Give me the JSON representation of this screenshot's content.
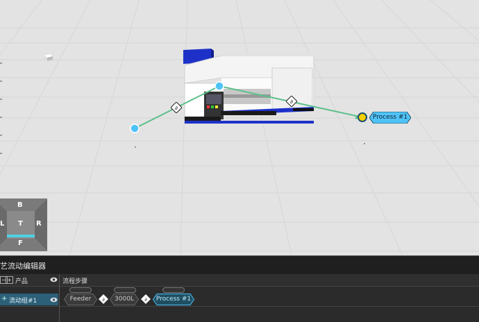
{
  "viewport": {
    "process_tag": "Process #1",
    "nav_cube": {
      "top": "B",
      "left": "L",
      "center": "T",
      "right": "R",
      "bottom": "F"
    }
  },
  "editor": {
    "title": "艺流动编辑器",
    "products_header": "产品",
    "steps_header": "流程步骤",
    "product_item": "流动组#1",
    "steps": [
      "Feeder",
      "3000L",
      "Process #1"
    ]
  },
  "colors": {
    "accent": "#4fc3f7",
    "link_line": "#5cc08a",
    "selected_row": "#2c5f78",
    "panel_bg": "#2b2b2b"
  }
}
